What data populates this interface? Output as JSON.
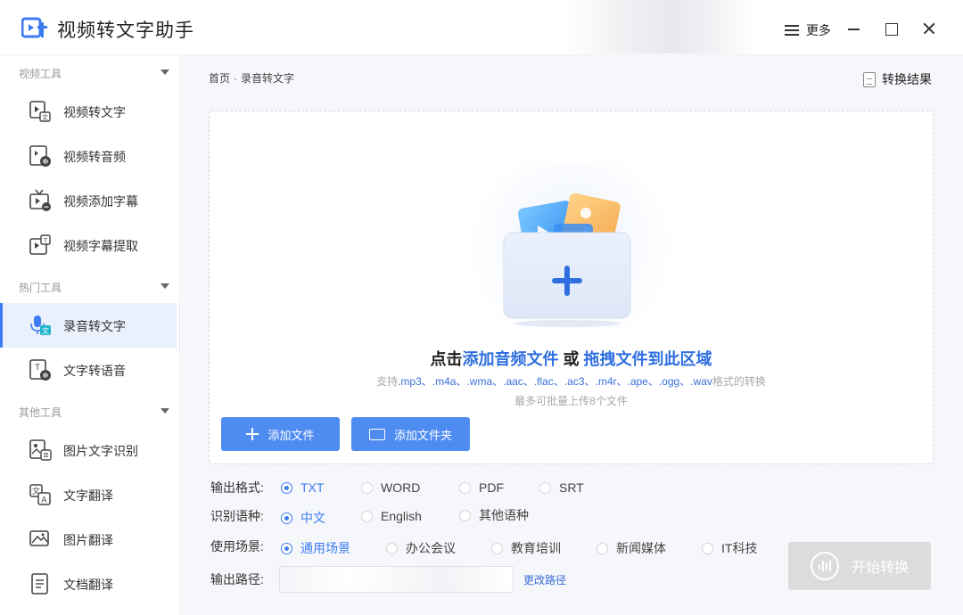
{
  "app": {
    "title": "视频转文字助手"
  },
  "window": {
    "more_label": "更多"
  },
  "sidebar": {
    "sections": [
      {
        "title": "视频工具",
        "items": [
          {
            "label": "视频转文字",
            "icon": "video-text-icon"
          },
          {
            "label": "视频转音频",
            "icon": "video-audio-icon"
          },
          {
            "label": "视频添加字幕",
            "icon": "tv-subtitle-icon"
          },
          {
            "label": "视频字幕提取",
            "icon": "subtitle-extract-icon"
          }
        ]
      },
      {
        "title": "热门工具",
        "items": [
          {
            "label": "录音转文字",
            "icon": "mic-text-icon",
            "active": true
          },
          {
            "label": "文字转语音",
            "icon": "text-speech-icon"
          }
        ]
      },
      {
        "title": "其他工具",
        "items": [
          {
            "label": "图片文字识别",
            "icon": "image-ocr-icon"
          },
          {
            "label": "文字翻译",
            "icon": "text-translate-icon"
          },
          {
            "label": "图片翻译",
            "icon": "image-translate-icon"
          },
          {
            "label": "文档翻译",
            "icon": "doc-translate-icon"
          }
        ]
      }
    ]
  },
  "breadcrumb": {
    "home": "首页",
    "separator": "-",
    "current": "录音转文字"
  },
  "result_link": "转换结果",
  "dropzone": {
    "title_prefix": "点击",
    "title_link1": "添加音频文件",
    "title_or": " 或 ",
    "title_link2": "拖拽文件到此区域",
    "support_prefix": "支持",
    "support_formats": ".mp3、.m4a、.wma、.aac、.flac、.ac3、.m4r、.ape、.ogg、.wav",
    "support_suffix": "格式的转换",
    "limit": "最多可批量上传8个文件"
  },
  "buttons": {
    "add_file": "添加文件",
    "add_folder": "添加文件夹",
    "start": "开始转换",
    "change_path": "更改路径"
  },
  "options": {
    "format": {
      "label": "输出格式:",
      "choices": [
        "TXT",
        "WORD",
        "PDF",
        "SRT"
      ],
      "selected": "TXT"
    },
    "language": {
      "label": "识别语种:",
      "choices": [
        "中文",
        "English",
        "其他语种"
      ],
      "selected": "中文"
    },
    "scene": {
      "label": "使用场景:",
      "choices": [
        "通用场景",
        "办公会议",
        "教育培训",
        "新闻媒体",
        "IT科技"
      ],
      "selected": "通用场景"
    },
    "path": {
      "label": "输出路径:"
    }
  },
  "colors": {
    "accent": "#3d7bf2",
    "button": "#4f8cf2",
    "disabled": "#dcdcdc"
  }
}
